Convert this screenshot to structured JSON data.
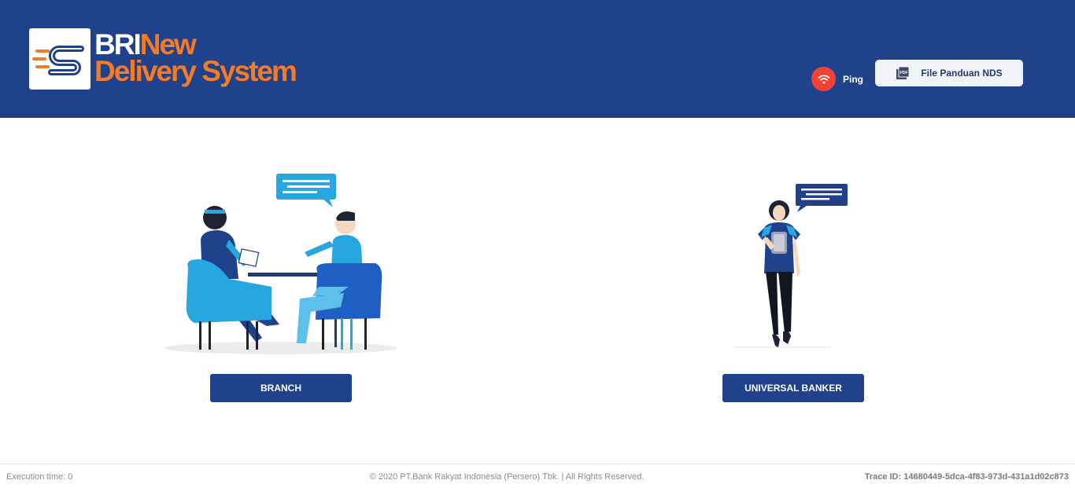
{
  "header": {
    "brand": {
      "line1_a": "BRI",
      "line1_b": "New",
      "line2": "Delivery System"
    },
    "ping": {
      "label": "Ping",
      "icon": "wifi-icon",
      "status_color": "#f24236"
    },
    "guide_button": {
      "label": "File Panduan NDS",
      "icon": "pdf-icon"
    }
  },
  "roles": [
    {
      "label": "BRANCH"
    },
    {
      "label": "UNIVERSAL BANKER"
    }
  ],
  "footer": {
    "execution": "Execution time: 0",
    "copyright": "© 2020 PT.Bank Rakyat Indonesia (Persero) Tbk. | All Rights Reserved.",
    "trace": "Trace ID: 14680449-5dca-4f83-973d-431a1d02c873"
  },
  "colors": {
    "header_bg": "#1f428b",
    "accent_orange": "#f47b27",
    "button_bg": "#1f428b"
  }
}
